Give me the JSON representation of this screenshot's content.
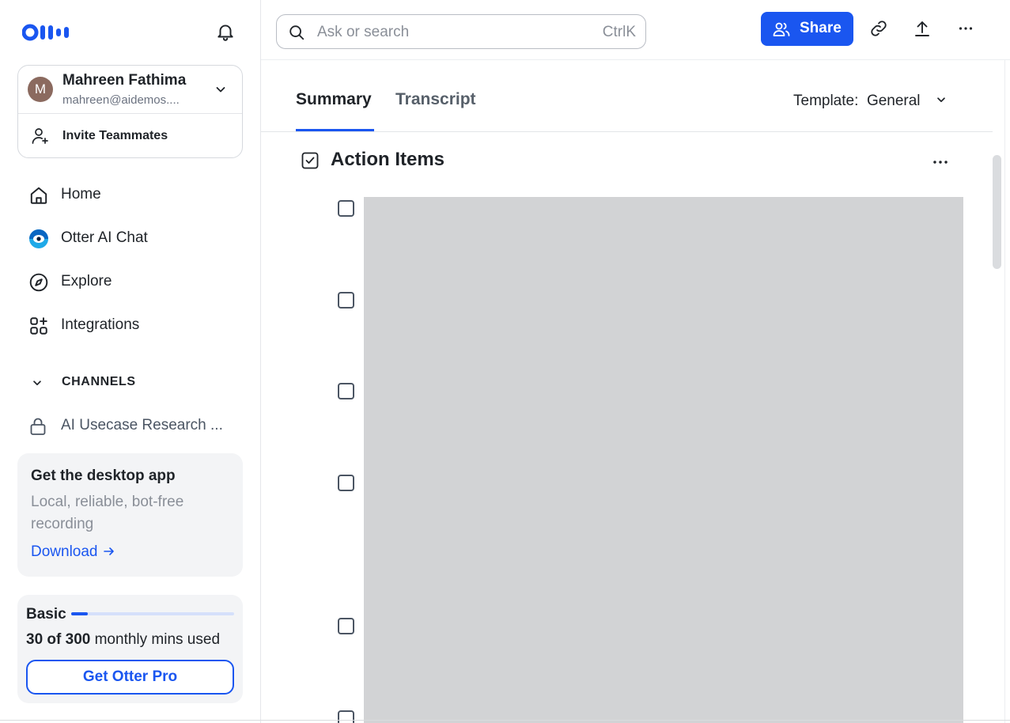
{
  "brand": {
    "name": "Otter",
    "accent": "#1a56f0"
  },
  "sidebar": {
    "account": {
      "avatar_initial": "M",
      "name": "Mahreen Fathima",
      "email": "mahreen@aidemos...."
    },
    "invite_label": "Invite Teammates",
    "nav": [
      {
        "label": "Home",
        "icon": "home-icon"
      },
      {
        "label": "Otter AI Chat",
        "icon": "otter-chat-icon"
      },
      {
        "label": "Explore",
        "icon": "compass-icon"
      },
      {
        "label": "Integrations",
        "icon": "apps-grid-icon"
      }
    ],
    "channels": {
      "header": "CHANNELS",
      "items": [
        {
          "label": "AI Usecase Research ...",
          "icon": "lock-icon"
        }
      ]
    },
    "promo": {
      "title": "Get the desktop app",
      "description": "Local, reliable, bot-free recording",
      "link_label": "Download"
    },
    "plan": {
      "name": "Basic",
      "used": "30 of 300",
      "usage_suffix": " monthly mins used",
      "progress_fraction": 0.1,
      "button_label": "Get Otter Pro"
    }
  },
  "topbar": {
    "search": {
      "placeholder": "Ask or search",
      "shortcut": "CtrlK"
    },
    "share_label": "Share",
    "icons": [
      "link-icon",
      "upload-icon",
      "more-horizontal-icon"
    ]
  },
  "main": {
    "tabs": [
      {
        "label": "Summary",
        "active": true
      },
      {
        "label": "Transcript",
        "active": false
      }
    ],
    "template": {
      "label": "Template:",
      "value": "General"
    },
    "section": {
      "title": "Action Items",
      "icon": "checkbox-checked-icon"
    },
    "action_items_count": 6
  }
}
